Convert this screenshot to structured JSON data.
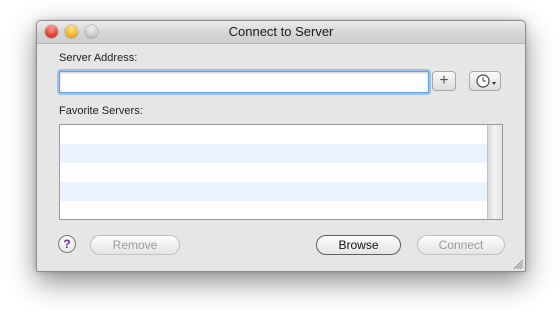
{
  "window": {
    "title": "Connect to Server"
  },
  "form": {
    "server_address_label": "Server Address:",
    "server_address_value": "",
    "add_icon": "plus-icon",
    "recent_icon": "clock-icon",
    "favorites_label": "Favorite Servers:",
    "favorites": []
  },
  "buttons": {
    "help_label": "?",
    "remove_label": "Remove",
    "browse_label": "Browse",
    "connect_label": "Connect"
  },
  "colors": {
    "close": "#e0362b",
    "minimize": "#f3b320",
    "zoom": "#c8c8c8",
    "focus_ring": "#9cc3ee",
    "list_stripe": "#edf3fe"
  }
}
